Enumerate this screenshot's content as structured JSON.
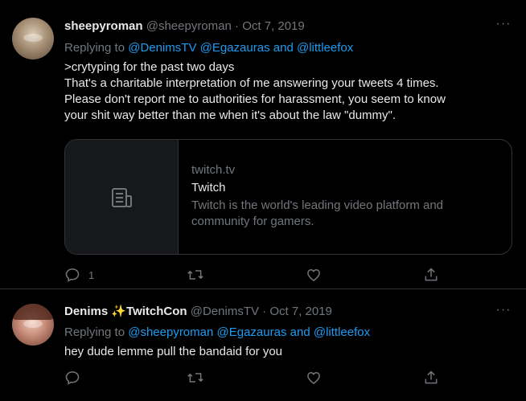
{
  "tweets": [
    {
      "display_name": "sheepyroman",
      "handle": "@sheepyroman",
      "separator": "·",
      "date": "Oct 7, 2019",
      "more_label": "···",
      "replying_prefix": "Replying to",
      "replying_to": [
        "@DenimsTV",
        "@Egazauras"
      ],
      "replying_and": "and",
      "replying_last": "@littleefox",
      "body_lines": [
        ">crytyping for the past two days",
        "That's a charitable interpretation of me answering your tweets 4 times.",
        "Please don't report me to authorities for harassment, you seem to know",
        "your shit way better than me when it's about the law \"dummy\"."
      ],
      "card": {
        "domain": "twitch.tv",
        "title": "Twitch",
        "description": "Twitch is the world's leading video platform and community for gamers.",
        "icon": "document-icon"
      },
      "actions": {
        "reply_count": "1",
        "retweet_count": "",
        "like_count": ""
      }
    },
    {
      "display_name": "Denims ✨TwitchCon",
      "handle": "@DenimsTV",
      "separator": "·",
      "date": "Oct 7, 2019",
      "more_label": "···",
      "replying_prefix": "Replying to",
      "replying_to": [
        "@sheepyroman",
        "@Egazauras"
      ],
      "replying_and": "and",
      "replying_last": "@littleefox",
      "body": "hey dude lemme pull the bandaid for you",
      "actions": {
        "reply_count": "",
        "retweet_count": "",
        "like_count": ""
      }
    }
  ],
  "colors": {
    "background": "#000000",
    "text": "#e7e9ea",
    "muted": "#71767b",
    "link": "#1d9bf0",
    "border": "#2f3336"
  }
}
